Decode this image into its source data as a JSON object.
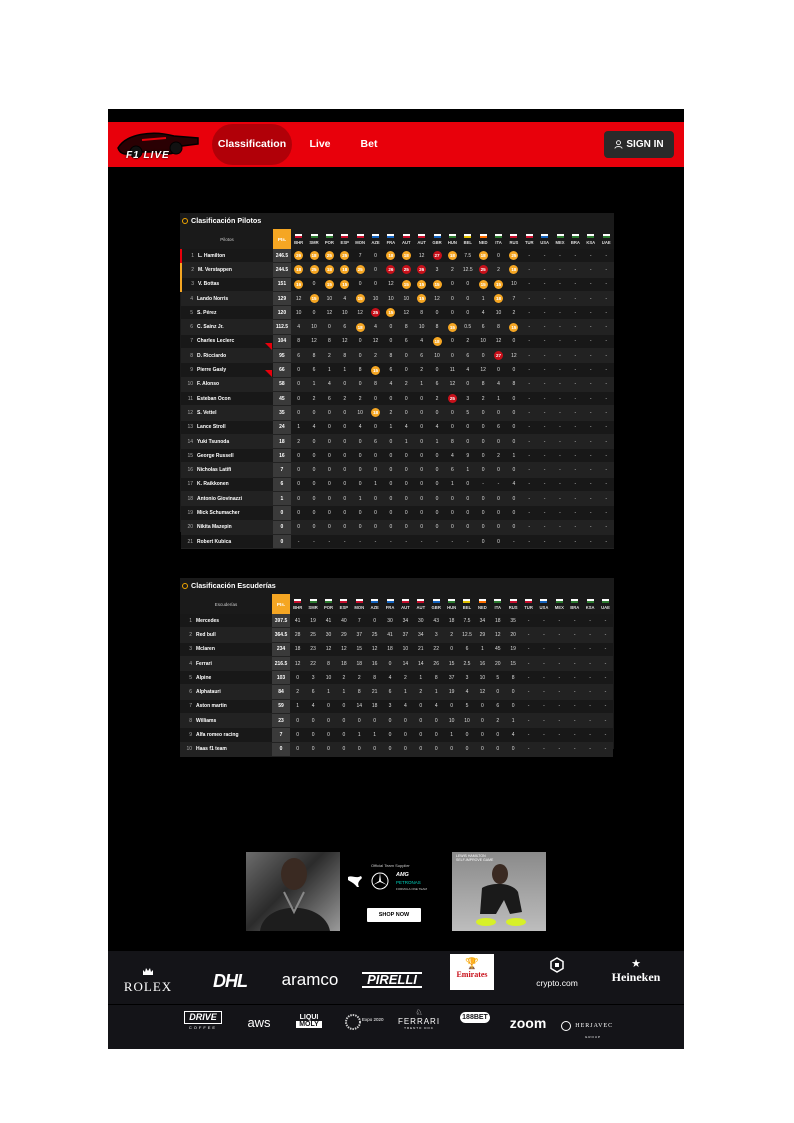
{
  "nav": {
    "logo_text": "F1 LIVE",
    "items": [
      {
        "label": "Classification",
        "active": true
      },
      {
        "label": "Live",
        "active": false
      },
      {
        "label": "Bet",
        "active": false
      }
    ],
    "sign_in_label": "SIGN IN"
  },
  "races": [
    "BHR",
    "SMR",
    "POR",
    "ESP",
    "MON",
    "AZE",
    "FRA",
    "AUT",
    "AUT",
    "GBR",
    "HUN",
    "BEL",
    "NED",
    "ITA",
    "RUS",
    "TUR",
    "USA",
    "MEX",
    "BRA",
    "KSA",
    "UAE"
  ],
  "drivers_table": {
    "title": "Clasificación Pilotos",
    "name_header": "Pilotos",
    "points_header": "Pts.",
    "rows": [
      {
        "pos": "1",
        "name": "L. Hamilton",
        "pts": "246.5",
        "r": [
          "26g",
          "18g",
          "25g",
          "25g",
          "7",
          "0",
          "18g",
          "18g",
          "12",
          "27r",
          "18g",
          "7.5",
          "18g",
          "0",
          "25g",
          "-",
          "-",
          "-",
          "-",
          "-",
          "-"
        ]
      },
      {
        "pos": "2",
        "name": "M. Verstappen",
        "pts": "244.5",
        "r": [
          "18g",
          "25g",
          "18g",
          "18g",
          "25g",
          "0",
          "26r",
          "25r",
          "26r",
          "3",
          "2",
          "12.5",
          "25r",
          "2",
          "18g",
          "-",
          "-",
          "-",
          "-",
          "-",
          "-"
        ]
      },
      {
        "pos": "3",
        "name": "V. Bottas",
        "pts": "151",
        "r": [
          "16g",
          "0",
          "15g",
          "15g",
          "0",
          "0",
          "12",
          "15g",
          "15g",
          "15g",
          "0",
          "0",
          "15g",
          "15g",
          "10",
          "-",
          "-",
          "-",
          "-",
          "-",
          "-"
        ]
      },
      {
        "pos": "4",
        "name": "Lando Norris",
        "pts": "129",
        "r": [
          "12",
          "15g",
          "10",
          "4",
          "15g",
          "10",
          "10",
          "10",
          "15g",
          "12",
          "0",
          "0",
          "1",
          "18g",
          "7",
          "-",
          "-",
          "-",
          "-",
          "-",
          "-"
        ]
      },
      {
        "pos": "5",
        "name": "S. Pérez",
        "pts": "120",
        "r": [
          "10",
          "0",
          "12",
          "10",
          "12",
          "25r",
          "15g",
          "12",
          "8",
          "0",
          "0",
          "0",
          "4",
          "10",
          "2",
          "-",
          "-",
          "-",
          "-",
          "-",
          "-"
        ]
      },
      {
        "pos": "6",
        "name": "C. Sainz Jr.",
        "pts": "112.5",
        "r": [
          "4",
          "10",
          "0",
          "6",
          "18g",
          "4",
          "0",
          "8",
          "10",
          "8",
          "15g",
          "0.5",
          "6",
          "8",
          "15g",
          "-",
          "-",
          "-",
          "-",
          "-",
          "-"
        ]
      },
      {
        "pos": "7",
        "name": "Charles Leclerc",
        "pts": "104",
        "r": [
          "8",
          "12",
          "8",
          "12",
          "0",
          "12",
          "0",
          "6",
          "4",
          "18g",
          "0",
          "2",
          "10",
          "12",
          "0",
          "-",
          "-",
          "-",
          "-",
          "-",
          "-"
        ]
      },
      {
        "pos": "8",
        "name": "D. Ricciardo",
        "pts": "95",
        "r": [
          "6",
          "8",
          "2",
          "8",
          "0",
          "2",
          "8",
          "0",
          "6",
          "10",
          "0",
          "6",
          "0",
          "27r",
          "12",
          "-",
          "-",
          "-",
          "-",
          "-",
          "-"
        ]
      },
      {
        "pos": "9",
        "name": "Pierre Gasly",
        "pts": "66",
        "r": [
          "0",
          "6",
          "1",
          "1",
          "8",
          "15g",
          "6",
          "0",
          "2",
          "0",
          "11",
          "4",
          "12",
          "0",
          "0",
          "-",
          "-",
          "-",
          "-",
          "-",
          "-"
        ]
      },
      {
        "pos": "10",
        "name": "F. Alonso",
        "pts": "58",
        "r": [
          "0",
          "1",
          "4",
          "0",
          "0",
          "8",
          "4",
          "2",
          "1",
          "6",
          "12",
          "0",
          "8",
          "4",
          "8",
          "-",
          "-",
          "-",
          "-",
          "-",
          "-"
        ]
      },
      {
        "pos": "11",
        "name": "Esteban Ocon",
        "pts": "45",
        "r": [
          "0",
          "2",
          "6",
          "2",
          "2",
          "0",
          "0",
          "0",
          "0",
          "2",
          "25r",
          "3",
          "2",
          "1",
          "0",
          "-",
          "-",
          "-",
          "-",
          "-",
          "-"
        ]
      },
      {
        "pos": "12",
        "name": "S. Vettel",
        "pts": "35",
        "r": [
          "0",
          "0",
          "0",
          "0",
          "10",
          "18g",
          "2",
          "0",
          "0",
          "0",
          "0",
          "5",
          "0",
          "0",
          "0",
          "-",
          "-",
          "-",
          "-",
          "-",
          "-"
        ]
      },
      {
        "pos": "13",
        "name": "Lance Stroll",
        "pts": "24",
        "r": [
          "1",
          "4",
          "0",
          "0",
          "4",
          "0",
          "1",
          "4",
          "0",
          "4",
          "0",
          "0",
          "0",
          "6",
          "0",
          "-",
          "-",
          "-",
          "-",
          "-",
          "-"
        ]
      },
      {
        "pos": "14",
        "name": "Yuki Tsunoda",
        "pts": "18",
        "r": [
          "2",
          "0",
          "0",
          "0",
          "0",
          "6",
          "0",
          "1",
          "0",
          "1",
          "8",
          "0",
          "0",
          "0",
          "0",
          "-",
          "-",
          "-",
          "-",
          "-",
          "-"
        ]
      },
      {
        "pos": "15",
        "name": "George Russell",
        "pts": "16",
        "r": [
          "0",
          "0",
          "0",
          "0",
          "0",
          "0",
          "0",
          "0",
          "0",
          "0",
          "4",
          "9",
          "0",
          "2",
          "1",
          "-",
          "-",
          "-",
          "-",
          "-",
          "-"
        ]
      },
      {
        "pos": "16",
        "name": "Nicholas Latifi",
        "pts": "7",
        "r": [
          "0",
          "0",
          "0",
          "0",
          "0",
          "0",
          "0",
          "0",
          "0",
          "0",
          "6",
          "1",
          "0",
          "0",
          "0",
          "-",
          "-",
          "-",
          "-",
          "-",
          "-"
        ]
      },
      {
        "pos": "17",
        "name": "K. Raikkonen",
        "pts": "6",
        "r": [
          "0",
          "0",
          "0",
          "0",
          "0",
          "1",
          "0",
          "0",
          "0",
          "0",
          "1",
          "0",
          "-",
          "-",
          "4",
          "-",
          "-",
          "-",
          "-",
          "-",
          "-"
        ]
      },
      {
        "pos": "18",
        "name": "Antonio Giovinazzi",
        "pts": "1",
        "r": [
          "0",
          "0",
          "0",
          "0",
          "1",
          "0",
          "0",
          "0",
          "0",
          "0",
          "0",
          "0",
          "0",
          "0",
          "0",
          "-",
          "-",
          "-",
          "-",
          "-",
          "-"
        ]
      },
      {
        "pos": "19",
        "name": "Mick Schumacher",
        "pts": "0",
        "r": [
          "0",
          "0",
          "0",
          "0",
          "0",
          "0",
          "0",
          "0",
          "0",
          "0",
          "0",
          "0",
          "0",
          "0",
          "0",
          "-",
          "-",
          "-",
          "-",
          "-",
          "-"
        ]
      },
      {
        "pos": "20",
        "name": "Nikita Mazepin",
        "pts": "0",
        "r": [
          "0",
          "0",
          "0",
          "0",
          "0",
          "0",
          "0",
          "0",
          "0",
          "0",
          "0",
          "0",
          "0",
          "0",
          "0",
          "-",
          "-",
          "-",
          "-",
          "-",
          "-"
        ]
      },
      {
        "pos": "21",
        "name": "Robert Kubica",
        "pts": "0",
        "r": [
          "-",
          "-",
          "-",
          "-",
          "-",
          "-",
          "-",
          "-",
          "-",
          "-",
          "-",
          "-",
          "0",
          "0",
          "-",
          "-",
          "-",
          "-",
          "-",
          "-",
          "-"
        ]
      }
    ]
  },
  "teams_table": {
    "title": "Clasificación Escuderías",
    "name_header": "Escuderías",
    "points_header": "Pts.",
    "rows": [
      {
        "pos": "1",
        "name": "Mercedes",
        "pts": "397.5",
        "r": [
          "41",
          "19",
          "41",
          "40",
          "7",
          "0",
          "30",
          "34",
          "30",
          "43",
          "18",
          "7.5",
          "34",
          "18",
          "35",
          "-",
          "-",
          "-",
          "-",
          "-",
          "-"
        ]
      },
      {
        "pos": "2",
        "name": "Red bull",
        "pts": "364.5",
        "r": [
          "28",
          "25",
          "30",
          "29",
          "37",
          "25",
          "41",
          "37",
          "34",
          "3",
          "2",
          "12.5",
          "29",
          "12",
          "20",
          "-",
          "-",
          "-",
          "-",
          "-",
          "-"
        ]
      },
      {
        "pos": "3",
        "name": "Mclaren",
        "pts": "234",
        "r": [
          "18",
          "23",
          "12",
          "12",
          "15",
          "12",
          "18",
          "10",
          "21",
          "22",
          "0",
          "6",
          "1",
          "45",
          "19",
          "-",
          "-",
          "-",
          "-",
          "-",
          "-"
        ]
      },
      {
        "pos": "4",
        "name": "Ferrari",
        "pts": "216.5",
        "r": [
          "12",
          "22",
          "8",
          "18",
          "18",
          "16",
          "0",
          "14",
          "14",
          "26",
          "15",
          "2.5",
          "16",
          "20",
          "15",
          "-",
          "-",
          "-",
          "-",
          "-",
          "-"
        ]
      },
      {
        "pos": "5",
        "name": "Alpine",
        "pts": "103",
        "r": [
          "0",
          "3",
          "10",
          "2",
          "2",
          "8",
          "4",
          "2",
          "1",
          "8",
          "37",
          "3",
          "10",
          "5",
          "8",
          "-",
          "-",
          "-",
          "-",
          "-",
          "-"
        ]
      },
      {
        "pos": "6",
        "name": "Alphatauri",
        "pts": "84",
        "r": [
          "2",
          "6",
          "1",
          "1",
          "8",
          "21",
          "6",
          "1",
          "2",
          "1",
          "19",
          "4",
          "12",
          "0",
          "0",
          "-",
          "-",
          "-",
          "-",
          "-",
          "-"
        ]
      },
      {
        "pos": "7",
        "name": "Aston martin",
        "pts": "59",
        "r": [
          "1",
          "4",
          "0",
          "0",
          "14",
          "18",
          "3",
          "4",
          "0",
          "4",
          "0",
          "5",
          "0",
          "6",
          "0",
          "-",
          "-",
          "-",
          "-",
          "-",
          "-"
        ]
      },
      {
        "pos": "8",
        "name": "Williams",
        "pts": "23",
        "r": [
          "0",
          "0",
          "0",
          "0",
          "0",
          "0",
          "0",
          "0",
          "0",
          "0",
          "10",
          "10",
          "0",
          "2",
          "1",
          "-",
          "-",
          "-",
          "-",
          "-",
          "-"
        ]
      },
      {
        "pos": "9",
        "name": "Alfa romeo racing",
        "pts": "7",
        "r": [
          "0",
          "0",
          "0",
          "0",
          "1",
          "1",
          "0",
          "0",
          "0",
          "0",
          "1",
          "0",
          "0",
          "0",
          "4",
          "-",
          "-",
          "-",
          "-",
          "-",
          "-"
        ]
      },
      {
        "pos": "10",
        "name": "Haas f1 team",
        "pts": "0",
        "r": [
          "0",
          "0",
          "0",
          "0",
          "0",
          "0",
          "0",
          "0",
          "0",
          "0",
          "0",
          "0",
          "0",
          "0",
          "0",
          "-",
          "-",
          "-",
          "-",
          "-",
          "-"
        ]
      }
    ]
  },
  "ad": {
    "supplier_text": "Official Team Supplier",
    "amg_text": "AMG",
    "petronas_text": "PETRONAS",
    "f1_team_text": "FORMULA ONE TEAM",
    "shop_now_label": "SHOP NOW",
    "right_caption": "LEWIS HAMILTON\nSELF-IMPROVE GAME"
  },
  "sponsors_row1": [
    "ROLEX",
    "DHL",
    "aramco",
    "PIRELLI",
    "Emirates",
    "crypto.com",
    "Heineken"
  ],
  "sponsors_row2": [
    "DRIVE",
    "COFFEE",
    "aws",
    "LIQUI",
    "MOLY",
    "Expo 2020",
    "FERRARI",
    "TRENTO DOC",
    "188BET",
    "zoom",
    "HERJAVEC",
    "GROUP"
  ],
  "colors": {
    "brand_red": "#e8000b",
    "gold": "#f5a623",
    "badge_red": "#c8101a",
    "panel": "#1a1a1a"
  }
}
